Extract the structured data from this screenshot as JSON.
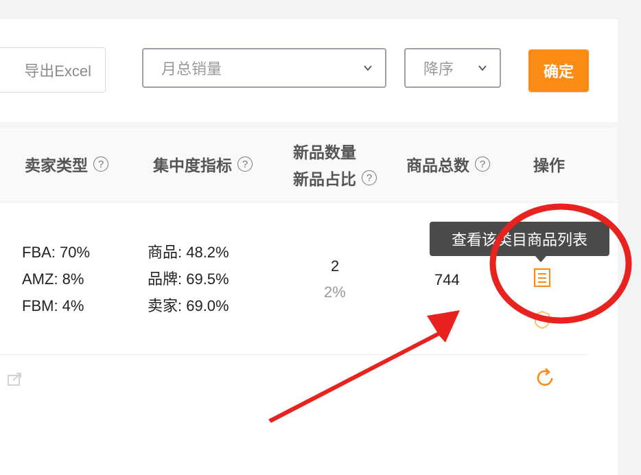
{
  "toolbar": {
    "export_label": "导出Excel",
    "sort_field": "月总销量",
    "sort_order": "降序",
    "confirm_label": "确定"
  },
  "table": {
    "headers": {
      "seller_type": "卖家类型",
      "concentration": "集中度指标",
      "new_count": "新品数量",
      "new_ratio": "新品占比",
      "total_products": "商品总数",
      "actions": "操作"
    },
    "row": {
      "seller_type": [
        "FBA: 70%",
        "AMZ: 8%",
        "FBM: 4%"
      ],
      "concentration": [
        "商品: 48.2%",
        "品牌: 69.5%",
        "卖家: 69.0%"
      ],
      "new_count": "2",
      "new_ratio": "2%",
      "total_products": "744"
    }
  },
  "tooltip": {
    "text": "查看该类目商品列表"
  },
  "colors": {
    "accent": "#fa8c16",
    "annotation": "#e8231f",
    "tooltip_bg": "#4a4a4a"
  },
  "icons": [
    "list-icon",
    "favorite-icon",
    "refresh-icon",
    "share-icon",
    "help-icon",
    "chevron-down-icon"
  ]
}
